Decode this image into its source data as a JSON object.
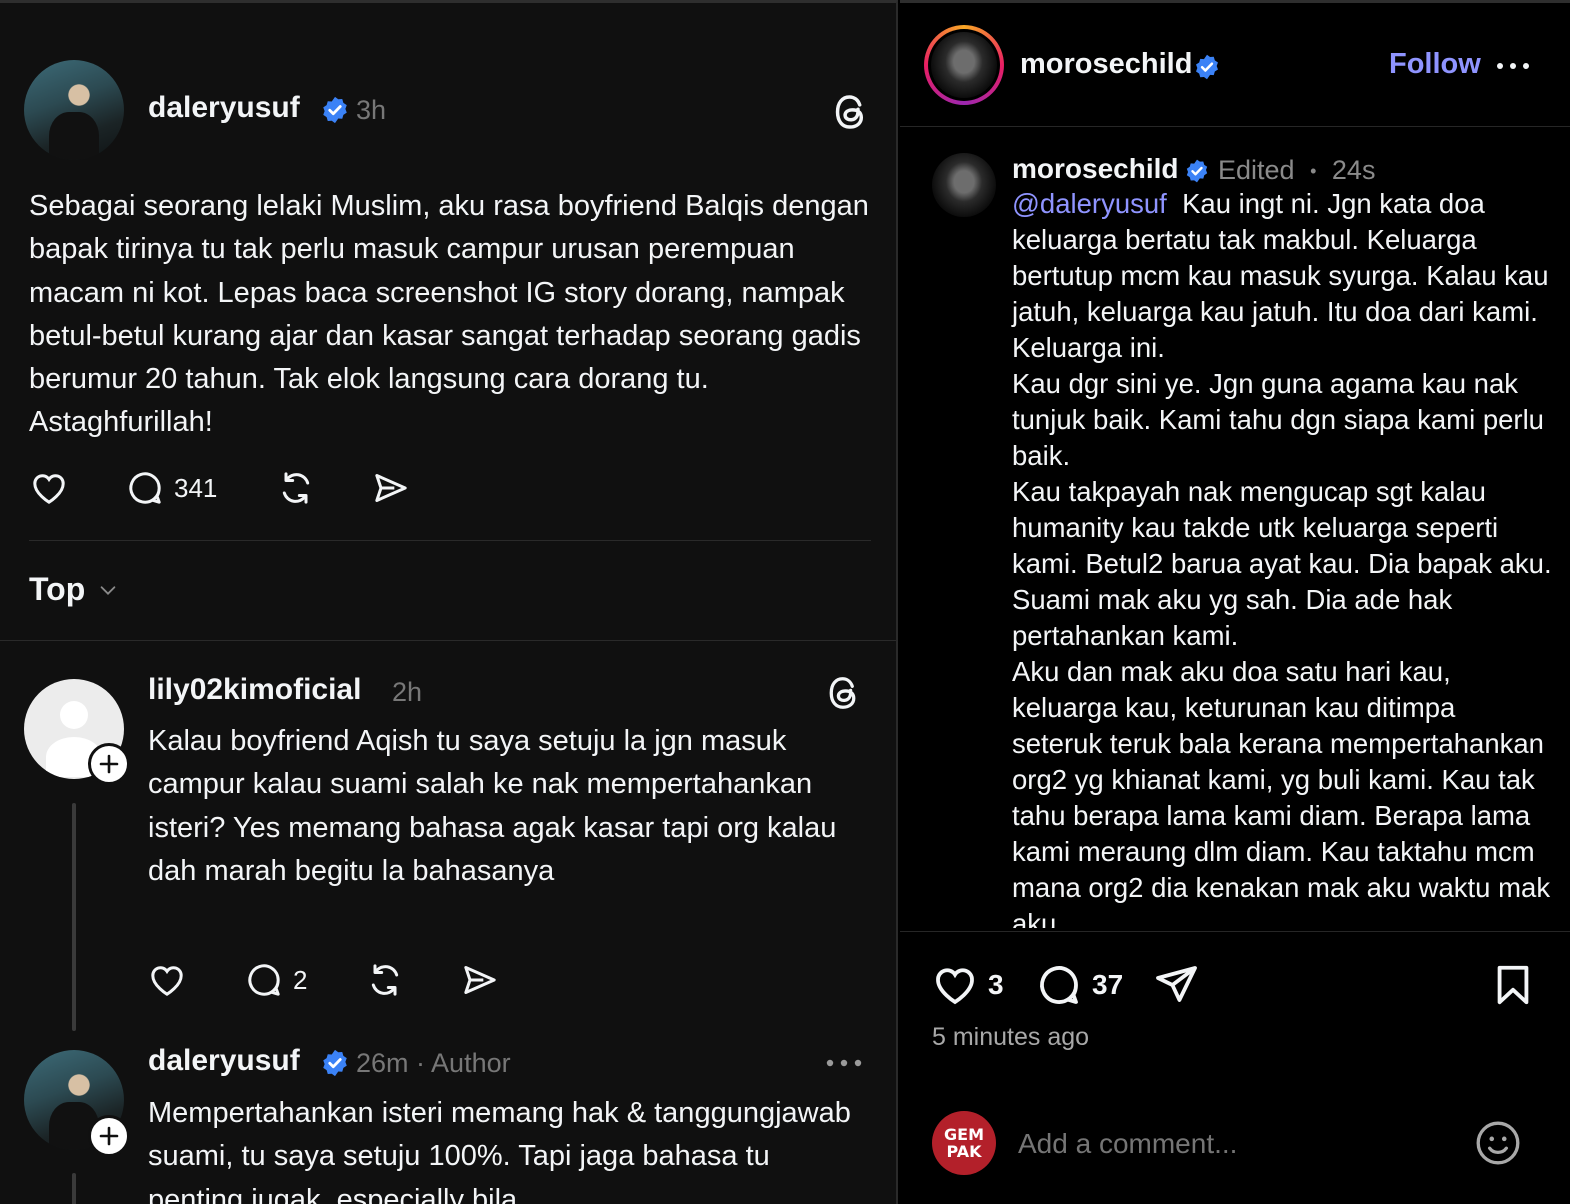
{
  "left_post": {
    "username": "daleryusuf",
    "time": "3h",
    "text": "Sebagai seorang lelaki Muslim, aku rasa boyfriend Balqis dengan bapak tirinya tu tak perlu masuk campur urusan perempuan macam ni kot. Lepas baca screenshot IG story dorang, nampak betul-betul kurang ajar dan kasar sangat terhadap seorang gadis berumur 20 tahun. Tak elok langsung cara dorang tu. Astaghfurillah!",
    "reply_count": "341"
  },
  "sort": {
    "label": "Top"
  },
  "reply1": {
    "username": "lily02kimoficial",
    "time": "2h",
    "text": "Kalau boyfriend Aqish tu saya setuju la jgn masuk campur kalau suami salah ke nak mempertahankan isteri? Yes memang bahasa agak kasar tapi org kalau dah marah begitu la bahasanya",
    "reply_count": "2"
  },
  "reply2": {
    "username": "daleryusuf",
    "time": "26m",
    "tag": "· Author",
    "text": "Mempertahankan isteri memang hak & tanggungjawab suami, tu saya setuju 100%. Tapi jaga bahasa tu penting jugak, especially bila"
  },
  "ig": {
    "header_username": "morosechild",
    "follow_label": "Follow",
    "comment_username": "morosechild",
    "edited_label": "Edited",
    "dot": "•",
    "comment_time": "24s",
    "mention": "@daleryusuf",
    "comment_text": "Kau ingt ni. Jgn kata doa keluarga bertatu tak makbul. Keluarga bertutup mcm kau masuk syurga. Kalau kau jatuh, keluarga kau jatuh. Itu doa dari kami. Keluarga ini.",
    "para2": "Kau dgr sini ye. Jgn guna agama kau nak tunjuk baik. Kami tahu dgn siapa kami perlu baik.",
    "para3": "Kau takpayah nak mengucap sgt kalau humanity kau takde utk keluarga seperti kami. Betul2 barua ayat kau. Dia bapak aku. Suami mak aku yg sah. Dia ade hak pertahankan kami.",
    "para4": "Aku dan mak aku doa satu hari kau, keluarga kau, keturunan kau ditimpa seteruk teruk bala kerana mempertahankan org2 yg khianat kami, yg buli kami. Kau tak tahu berapa lama kami diam. Berapa lama kami meraung dlm diam. Kau taktahu mcm mana org2 dia kenakan mak aku waktu mak aku",
    "likes": "3",
    "comments": "37",
    "posted": "5 minutes ago",
    "comment_placeholder": "Add a comment...",
    "logo_text": "GEM PAK"
  },
  "colors": {
    "verified": "#3b82f6",
    "link": "#8f94ff",
    "follow": "#8f94ff"
  }
}
